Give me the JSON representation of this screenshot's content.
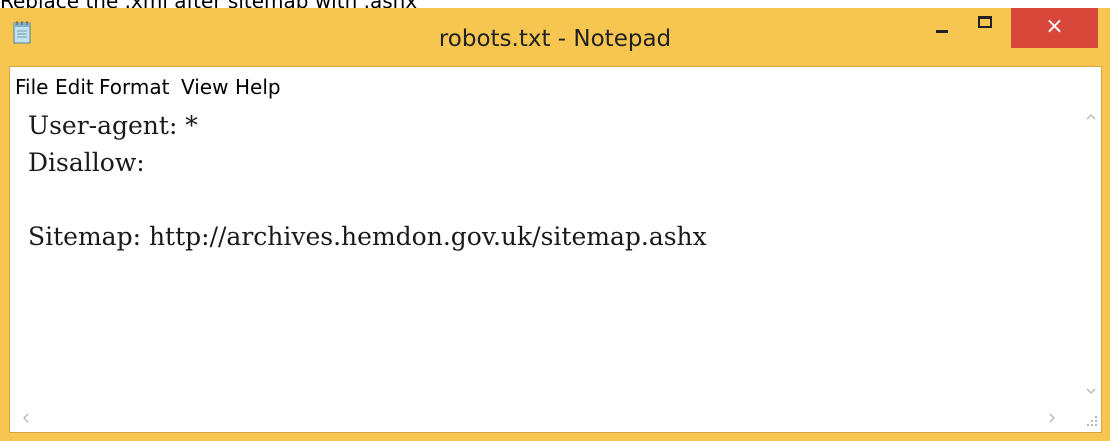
{
  "caption": "Replace the .xml after sitemap with .ashx",
  "window": {
    "title": "robots.txt - Notepad",
    "close_glyph": "×",
    "accent_color": "#f6c650",
    "close_color": "#d9463a"
  },
  "menu": {
    "items": [
      "File",
      "Edit",
      "Format",
      "View",
      "Help"
    ]
  },
  "editor": {
    "lines": [
      "User-agent: *",
      "Disallow:",
      "",
      "Sitemap: http://archives.hemdon.gov.uk/sitemap.ashx"
    ]
  },
  "icons": {
    "app": "notepad-icon",
    "minimize": "minimize-icon",
    "maximize": "maximize-icon",
    "close": "close-icon",
    "resize": "size-grip-icon"
  }
}
